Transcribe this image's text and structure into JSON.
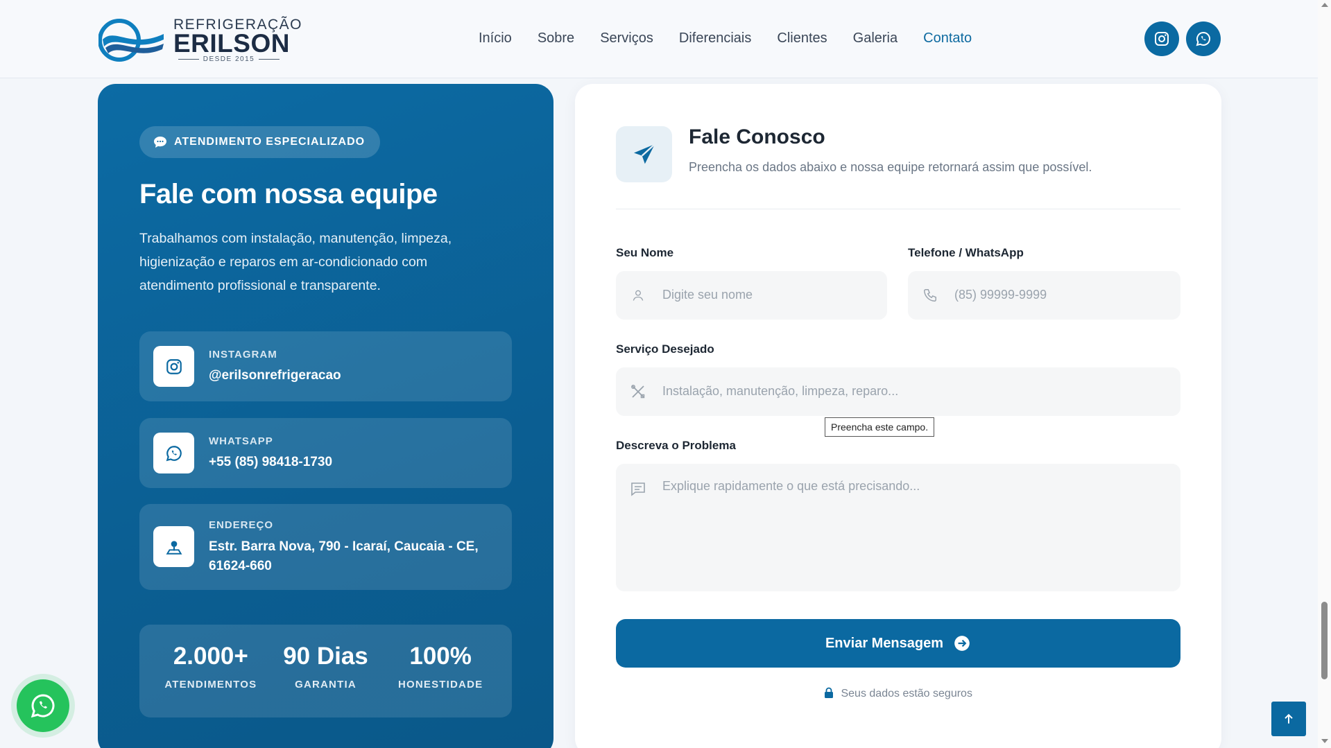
{
  "header": {
    "logo": {
      "top": "REFRIGERAÇÃO",
      "main": "ERILSON",
      "since": "DESDE 2015"
    },
    "nav": [
      "Início",
      "Sobre",
      "Serviços",
      "Diferenciais",
      "Clientes",
      "Galeria",
      "Contato"
    ],
    "active_nav": "Contato",
    "icons": [
      "instagram-icon",
      "whatsapp-icon"
    ]
  },
  "left": {
    "badge": "ATENDIMENTO ESPECIALIZADO",
    "title": "Fale com nossa equipe",
    "description": "Trabalhamos com instalação, manutenção, limpeza, higienização e reparos em ar-condicionado com atendimento profissional e transparente.",
    "cards": [
      {
        "icon": "instagram-icon",
        "label": "INSTAGRAM",
        "value": "@erilsonrefrigeracao"
      },
      {
        "icon": "whatsapp-icon",
        "label": "WHATSAPP",
        "value": "+55 (85) 98418-1730"
      },
      {
        "icon": "map-pin-icon",
        "label": "ENDEREÇO",
        "value": "Estr. Barra Nova, 790 - Icaraí, Caucaia - CE, 61624-660"
      }
    ],
    "stats": [
      {
        "value": "2.000+",
        "label": "ATENDIMENTOS"
      },
      {
        "value": "90 Dias",
        "label": "GARANTIA"
      },
      {
        "value": "100%",
        "label": "HONESTIDADE"
      }
    ]
  },
  "form": {
    "title": "Fale Conosco",
    "subtitle": "Preencha os dados abaixo e nossa equipe retornará assim que possível.",
    "name": {
      "label": "Seu Nome",
      "placeholder": "Digite seu nome",
      "value": ""
    },
    "phone": {
      "label": "Telefone / WhatsApp",
      "placeholder": "(85) 99999-9999",
      "value": ""
    },
    "service": {
      "label": "Serviço Desejado",
      "placeholder": "Instalação, manutenção, limpeza, reparo...",
      "value": ""
    },
    "tooltip": "Preencha este campo.",
    "problem": {
      "label": "Descreva o Problema",
      "placeholder": "Explique rapidamente o que está precisando...",
      "value": ""
    },
    "submit": "Enviar Mensagem",
    "secure": "Seus dados estão seguros"
  },
  "colors": {
    "brand": "#0b69a1",
    "whatsapp": "#25c35c",
    "background": "#f3f6fa"
  }
}
